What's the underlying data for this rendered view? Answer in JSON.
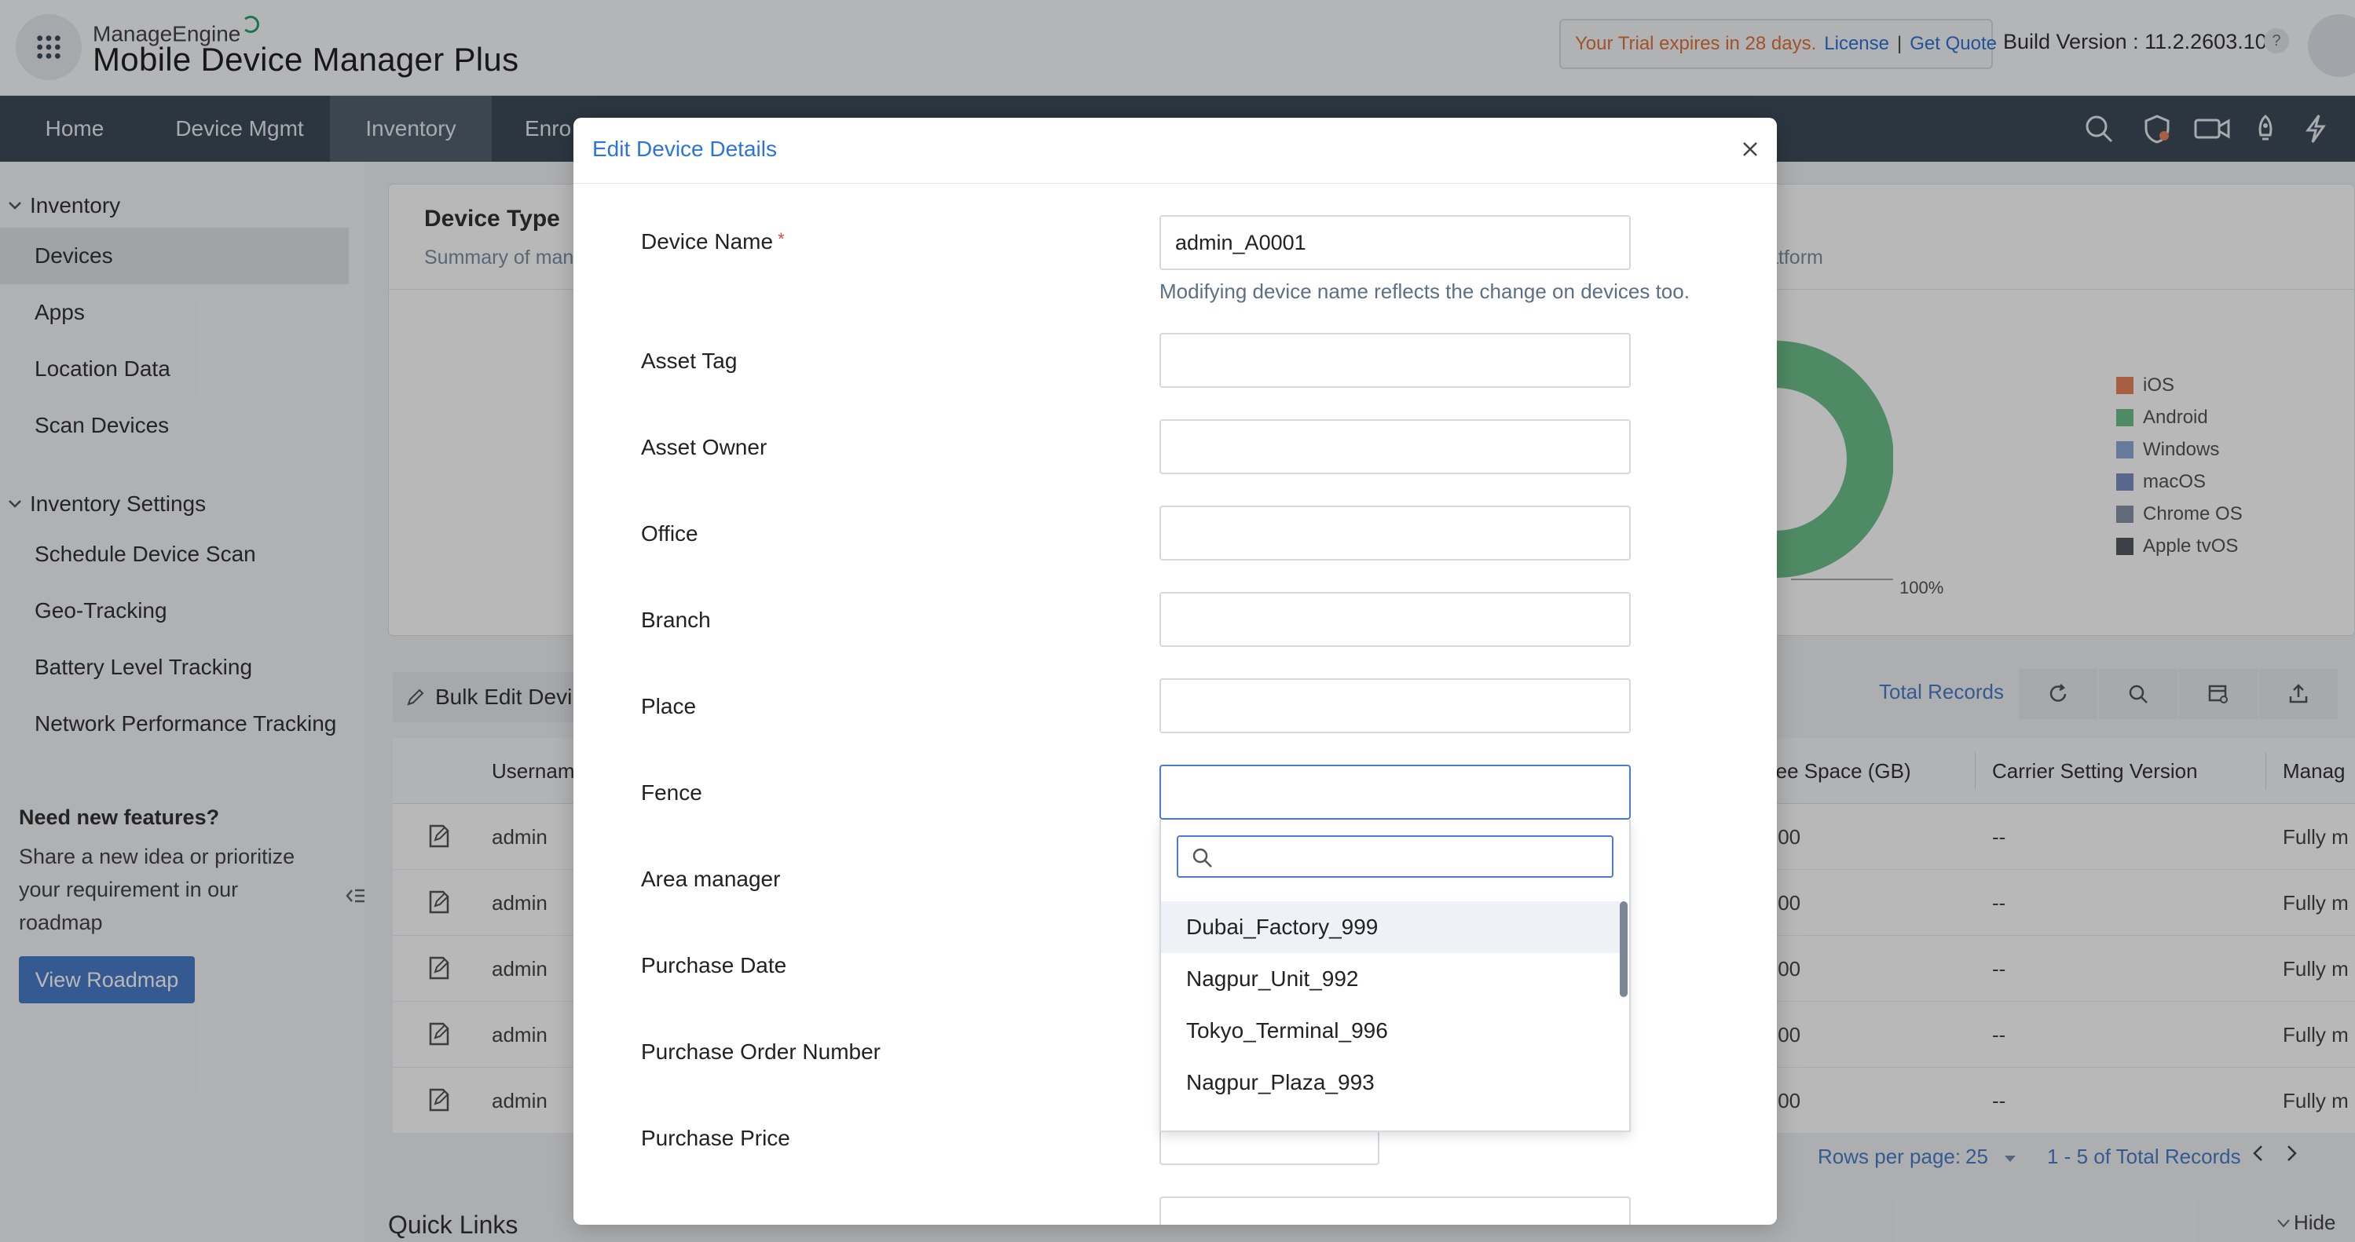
{
  "header": {
    "brand_small": "ManageEngine",
    "brand_big": "Mobile Device Manager Plus",
    "trial_text": "Your Trial expires in 28 days.",
    "license_link": "License",
    "separator": "|",
    "quote_link": "Get Quote",
    "build_version": "Build Version : 11.2.2603.10",
    "help": "?"
  },
  "nav": {
    "items": [
      "Home",
      "Device Mgmt",
      "Inventory",
      "Enro"
    ],
    "active": "Inventory"
  },
  "sidebar": {
    "section1": "Inventory",
    "section1_items": [
      "Devices",
      "Apps",
      "Location Data",
      "Scan Devices"
    ],
    "section2": "Inventory Settings",
    "section2_items": [
      "Schedule Device Scan",
      "Geo-Tracking",
      "Battery Level Tracking",
      "Network Performance Tracking"
    ],
    "feature_title": "Need new features?",
    "feature_text": "Share a new idea or prioritize your requirement in our roadmap",
    "roadmap_button": "View Roadmap"
  },
  "card": {
    "title": "Device Type",
    "subtitle_left": "Summary of man",
    "subtitle_right": "atform",
    "percent_label": "100%",
    "legend": [
      {
        "name": "iOS",
        "color": "#e8845c"
      },
      {
        "name": "Android",
        "color": "#6cc08b"
      },
      {
        "name": "Windows",
        "color": "#8ea9d8"
      },
      {
        "name": "macOS",
        "color": "#7b8fc1"
      },
      {
        "name": "Chrome OS",
        "color": "#8a94a6"
      },
      {
        "name": "Apple tvOS",
        "color": "#555a62"
      }
    ]
  },
  "toolbar": {
    "bulk_edit": "Bulk Edit Devi",
    "total_records": "Total Records"
  },
  "table": {
    "headers": [
      "Usernam",
      "ree Space (GB)",
      "Carrier Setting Version",
      "Manag"
    ],
    "rows": [
      {
        "user": "admin",
        "space": ".00",
        "carrier": "--",
        "manage": "Fully m"
      },
      {
        "user": "admin",
        "space": ".00",
        "carrier": "--",
        "manage": "Fully m"
      },
      {
        "user": "admin",
        "space": ".00",
        "carrier": "--",
        "manage": "Fully m"
      },
      {
        "user": "admin",
        "space": ".00",
        "carrier": "--",
        "manage": "Fully m"
      },
      {
        "user": "admin",
        "space": ".00",
        "carrier": "--",
        "manage": "Fully m"
      }
    ],
    "rows_per_page_label": "Rows per page:",
    "rows_per_page": "25",
    "range": "1 - 5 of Total Records"
  },
  "footer": {
    "quick_links": "Quick Links",
    "hide": "Hide"
  },
  "modal": {
    "title": "Edit Device Details",
    "required_mark": "*",
    "fields": {
      "device_name": {
        "label": "Device Name",
        "value": "admin_A0001"
      },
      "helper": "Modifying device name reflects the change on devices too.",
      "asset_tag": {
        "label": "Asset Tag",
        "value": ""
      },
      "asset_owner": {
        "label": "Asset Owner",
        "value": ""
      },
      "office": {
        "label": "Office",
        "value": ""
      },
      "branch": {
        "label": "Branch",
        "value": ""
      },
      "place": {
        "label": "Place",
        "value": ""
      },
      "fence": {
        "label": "Fence",
        "value": ""
      },
      "area_manager": {
        "label": "Area manager"
      },
      "purchase_date": {
        "label": "Purchase Date"
      },
      "purchase_order": {
        "label": "Purchase Order Number"
      },
      "purchase_price": {
        "label": "Purchase Price"
      }
    },
    "dropdown": {
      "search_value": "",
      "options": [
        "Dubai_Factory_999",
        "Nagpur_Unit_992",
        "Tokyo_Terminal_996",
        "Nagpur_Plaza_993"
      ],
      "highlighted": "Dubai_Factory_999"
    }
  }
}
